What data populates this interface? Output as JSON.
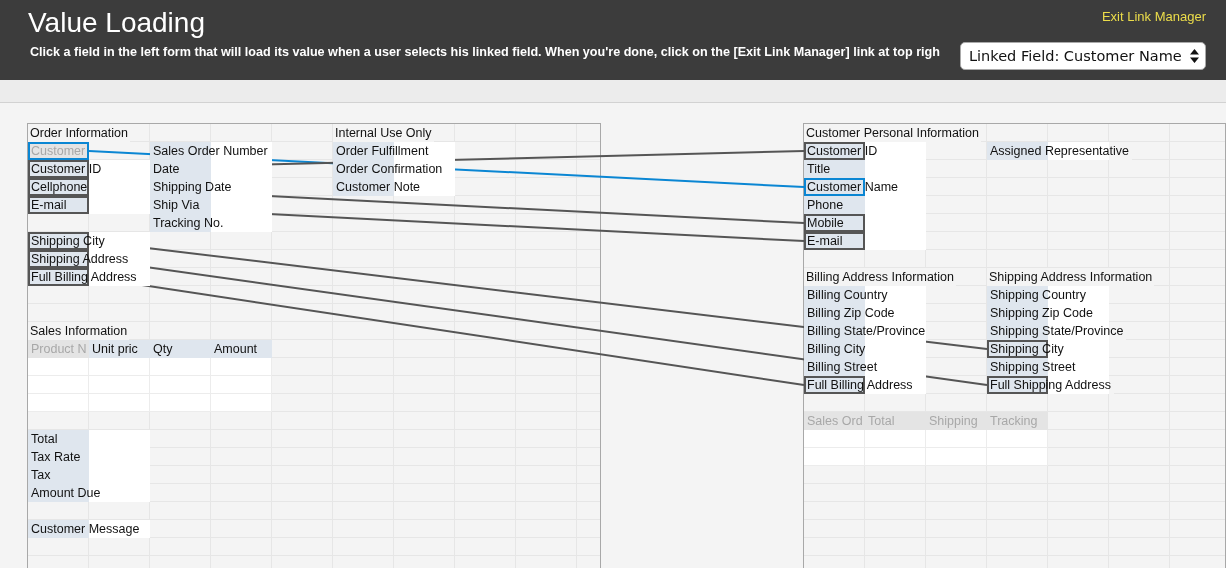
{
  "header": {
    "title": "Value Loading",
    "instructions": "Click a field in the left form that will load its value when a user selects his linked field. When you're done, click on the [Exit Link Manager] link at top righ",
    "exit_link": "Exit Link Manager",
    "linked_field_select": {
      "value": "Linked Field: Customer Name"
    }
  },
  "left_sheet": {
    "rows": [
      {
        "kind": "cells",
        "cells": [
          {
            "kind": "heading",
            "text": "Order Information"
          },
          {
            "kind": "blank"
          },
          {
            "kind": "blank"
          },
          {
            "kind": "blank"
          },
          {
            "kind": "blank"
          },
          {
            "kind": "heading",
            "text": "Internal Use Only"
          }
        ]
      },
      {
        "kind": "cells",
        "cells": [
          {
            "kind": "label",
            "text": "Customer",
            "disabled": true
          },
          {
            "kind": "blank"
          },
          {
            "kind": "label",
            "text": "Sales Order Number",
            "disabled": false
          },
          {
            "kind": "input"
          },
          {
            "kind": "blank"
          },
          {
            "kind": "label",
            "text": "Order Fulfillment",
            "disabled": false
          },
          {
            "kind": "input"
          }
        ]
      },
      {
        "kind": "cells",
        "cells": [
          {
            "kind": "label",
            "text": "Customer ID",
            "disabled": false
          },
          {
            "kind": "input"
          },
          {
            "kind": "label",
            "text": "Date",
            "disabled": false
          },
          {
            "kind": "input"
          },
          {
            "kind": "blank"
          },
          {
            "kind": "label",
            "text": "Order Confirmation",
            "disabled": false
          },
          {
            "kind": "input"
          }
        ]
      },
      {
        "kind": "cells",
        "cells": [
          {
            "kind": "label",
            "text": "Cellphone",
            "disabled": false
          },
          {
            "kind": "input"
          },
          {
            "kind": "label",
            "text": "Shipping Date",
            "disabled": false
          },
          {
            "kind": "input"
          },
          {
            "kind": "blank"
          },
          {
            "kind": "label",
            "text": "Customer Note",
            "disabled": false
          },
          {
            "kind": "input"
          }
        ]
      },
      {
        "kind": "cells",
        "cells": [
          {
            "kind": "label",
            "text": "E-mail",
            "disabled": false
          },
          {
            "kind": "input"
          },
          {
            "kind": "label",
            "text": "Ship Via",
            "disabled": false
          },
          {
            "kind": "input"
          }
        ]
      },
      {
        "kind": "cells",
        "cells": [
          {
            "kind": "blank"
          },
          {
            "kind": "blank"
          },
          {
            "kind": "label",
            "text": "Tracking No.",
            "disabled": false
          },
          {
            "kind": "input"
          }
        ]
      },
      {
        "kind": "cells",
        "cells": [
          {
            "kind": "label",
            "text": "Shipping City",
            "disabled": false
          },
          {
            "kind": "input"
          }
        ]
      },
      {
        "kind": "cells",
        "cells": [
          {
            "kind": "label",
            "text": "Shipping Address",
            "disabled": false
          },
          {
            "kind": "input"
          }
        ]
      },
      {
        "kind": "cells",
        "cells": [
          {
            "kind": "label",
            "text": "Full Billing Address",
            "disabled": false
          },
          {
            "kind": "input"
          }
        ]
      },
      {
        "kind": "empty"
      },
      {
        "kind": "empty"
      },
      {
        "kind": "cells",
        "cells": [
          {
            "kind": "heading",
            "text": "Sales Information"
          }
        ]
      },
      {
        "kind": "cells",
        "cells": [
          {
            "kind": "label",
            "text": "Product N",
            "disabled": true
          },
          {
            "kind": "label",
            "text": "Unit pric",
            "disabled": false
          },
          {
            "kind": "label",
            "text": "Qty",
            "disabled": false
          },
          {
            "kind": "label",
            "text": "Amount",
            "disabled": false
          }
        ]
      },
      {
        "kind": "cells",
        "cells": [
          {
            "kind": "input"
          },
          {
            "kind": "input"
          },
          {
            "kind": "input"
          },
          {
            "kind": "input"
          }
        ]
      },
      {
        "kind": "cells",
        "cells": [
          {
            "kind": "input"
          },
          {
            "kind": "input"
          },
          {
            "kind": "input"
          },
          {
            "kind": "input"
          }
        ]
      },
      {
        "kind": "cells",
        "cells": [
          {
            "kind": "input"
          },
          {
            "kind": "input"
          },
          {
            "kind": "input"
          },
          {
            "kind": "input"
          }
        ]
      },
      {
        "kind": "empty"
      },
      {
        "kind": "cells",
        "cells": [
          {
            "kind": "label",
            "text": "Total",
            "disabled": false
          },
          {
            "kind": "input"
          }
        ]
      },
      {
        "kind": "cells",
        "cells": [
          {
            "kind": "label",
            "text": "Tax Rate",
            "disabled": false
          },
          {
            "kind": "input"
          }
        ]
      },
      {
        "kind": "cells",
        "cells": [
          {
            "kind": "label",
            "text": "Tax",
            "disabled": false
          },
          {
            "kind": "input"
          }
        ]
      },
      {
        "kind": "cells",
        "cells": [
          {
            "kind": "label",
            "text": "Amount Due",
            "disabled": false
          },
          {
            "kind": "input"
          }
        ]
      },
      {
        "kind": "empty"
      },
      {
        "kind": "cells",
        "cells": [
          {
            "kind": "label",
            "text": "Customer Message",
            "disabled": false
          },
          {
            "kind": "input"
          }
        ]
      }
    ]
  },
  "right_sheet": {
    "rows": [
      {
        "kind": "cells",
        "cells": [
          {
            "kind": "heading",
            "text": "Customer Personal Information"
          }
        ]
      },
      {
        "kind": "cells",
        "cells": [
          {
            "kind": "label",
            "text": "Customer ID",
            "disabled": false
          },
          {
            "kind": "input"
          },
          {
            "kind": "blank"
          },
          {
            "kind": "label",
            "text": "Assigned Representative",
            "disabled": false
          },
          {
            "kind": "input"
          }
        ]
      },
      {
        "kind": "cells",
        "cells": [
          {
            "kind": "label",
            "text": "Title",
            "disabled": false
          },
          {
            "kind": "input"
          }
        ]
      },
      {
        "kind": "cells",
        "cells": [
          {
            "kind": "label",
            "text": "Customer Name",
            "disabled": false
          },
          {
            "kind": "input"
          }
        ]
      },
      {
        "kind": "cells",
        "cells": [
          {
            "kind": "label",
            "text": "Phone",
            "disabled": false
          },
          {
            "kind": "input"
          }
        ]
      },
      {
        "kind": "cells",
        "cells": [
          {
            "kind": "label",
            "text": "Mobile",
            "disabled": false
          },
          {
            "kind": "input"
          }
        ]
      },
      {
        "kind": "cells",
        "cells": [
          {
            "kind": "label",
            "text": "E-mail",
            "disabled": false
          },
          {
            "kind": "input"
          }
        ]
      },
      {
        "kind": "empty"
      },
      {
        "kind": "cells",
        "cells": [
          {
            "kind": "heading",
            "text": "Billing Address Information"
          },
          {
            "kind": "blank"
          },
          {
            "kind": "blank"
          },
          {
            "kind": "heading",
            "text": "Shipping Address Information"
          }
        ]
      },
      {
        "kind": "cells",
        "cells": [
          {
            "kind": "label",
            "text": "Billing Country",
            "disabled": false
          },
          {
            "kind": "input"
          },
          {
            "kind": "blank"
          },
          {
            "kind": "label",
            "text": "Shipping Country",
            "disabled": false
          },
          {
            "kind": "input"
          }
        ]
      },
      {
        "kind": "cells",
        "cells": [
          {
            "kind": "label",
            "text": "Billing Zip Code",
            "disabled": false
          },
          {
            "kind": "input"
          },
          {
            "kind": "blank"
          },
          {
            "kind": "label",
            "text": "Shipping Zip Code",
            "disabled": false
          },
          {
            "kind": "input"
          }
        ]
      },
      {
        "kind": "cells",
        "cells": [
          {
            "kind": "label",
            "text": "Billing State/Province",
            "disabled": false
          },
          {
            "kind": "input"
          },
          {
            "kind": "blank"
          },
          {
            "kind": "label",
            "text": "Shipping State/Province",
            "disabled": false
          },
          {
            "kind": "input"
          }
        ]
      },
      {
        "kind": "cells",
        "cells": [
          {
            "kind": "label",
            "text": "Billing City",
            "disabled": false
          },
          {
            "kind": "input"
          },
          {
            "kind": "blank"
          },
          {
            "kind": "label",
            "text": "Shipping City",
            "disabled": false
          },
          {
            "kind": "input"
          }
        ]
      },
      {
        "kind": "cells",
        "cells": [
          {
            "kind": "label",
            "text": "Billing Street",
            "disabled": false
          },
          {
            "kind": "input"
          },
          {
            "kind": "blank"
          },
          {
            "kind": "label",
            "text": "Shipping Street",
            "disabled": false
          },
          {
            "kind": "input"
          }
        ]
      },
      {
        "kind": "cells",
        "cells": [
          {
            "kind": "label",
            "text": "Full Billing Address",
            "disabled": false
          },
          {
            "kind": "input"
          },
          {
            "kind": "blank"
          },
          {
            "kind": "label",
            "text": "Full Shipping Address",
            "disabled": false
          },
          {
            "kind": "input"
          }
        ]
      },
      {
        "kind": "empty"
      },
      {
        "kind": "cells",
        "cells": [
          {
            "kind": "label",
            "text": "Sales Ord",
            "disabled": true
          },
          {
            "kind": "label",
            "text": "Total",
            "disabled": true
          },
          {
            "kind": "label",
            "text": "Shipping",
            "disabled": true
          },
          {
            "kind": "label",
            "text": "Tracking",
            "disabled": true
          }
        ]
      },
      {
        "kind": "cells",
        "cells": [
          {
            "kind": "input"
          },
          {
            "kind": "input"
          },
          {
            "kind": "input"
          },
          {
            "kind": "input"
          }
        ]
      },
      {
        "kind": "cells",
        "cells": [
          {
            "kind": "input"
          },
          {
            "kind": "input"
          },
          {
            "kind": "input"
          },
          {
            "kind": "input"
          }
        ]
      }
    ]
  },
  "links": [
    {
      "selected": true
    },
    {
      "selected": false
    },
    {
      "selected": false
    },
    {
      "selected": false
    },
    {
      "selected": false
    },
    {
      "selected": false
    },
    {
      "selected": false
    }
  ]
}
